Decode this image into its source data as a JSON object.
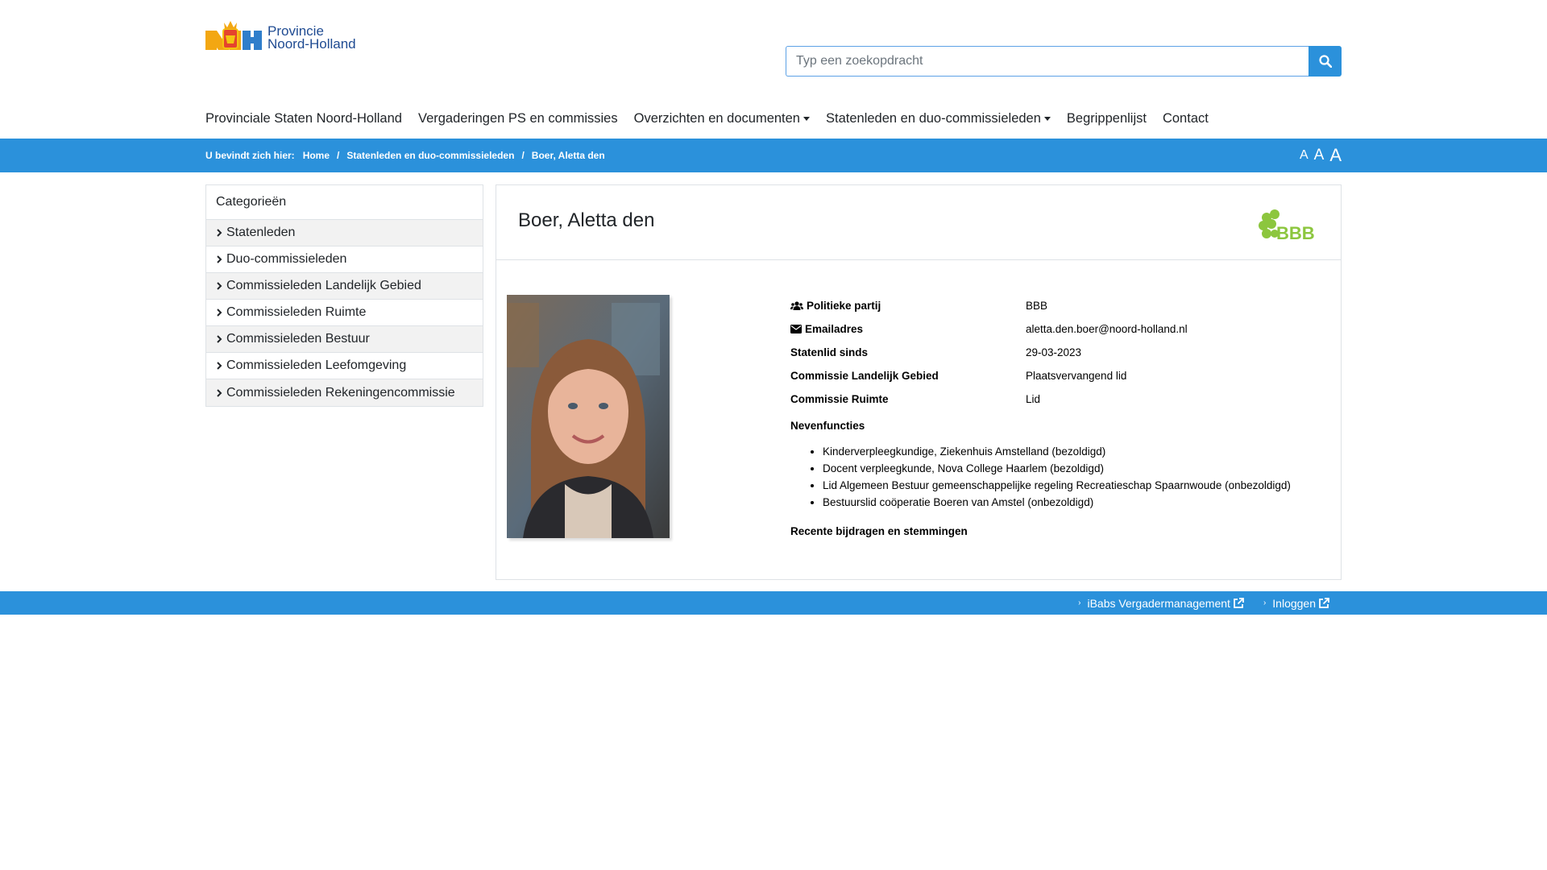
{
  "header": {
    "logo_line1": "Provincie",
    "logo_line2": "Noord-Holland",
    "search_placeholder": "Typ een zoekopdracht"
  },
  "nav": {
    "items": [
      {
        "label": "Provinciale Staten Noord-Holland",
        "dropdown": false
      },
      {
        "label": "Vergaderingen PS en commissies",
        "dropdown": false
      },
      {
        "label": "Overzichten en documenten",
        "dropdown": true
      },
      {
        "label": "Statenleden en duo-commissieleden",
        "dropdown": true
      },
      {
        "label": "Begrippenlijst",
        "dropdown": false
      },
      {
        "label": "Contact",
        "dropdown": false
      }
    ]
  },
  "breadcrumb": {
    "label": "U bevindt zich hier:",
    "items": [
      "Home",
      "Statenleden en duo-commissieleden",
      "Boer, Aletta den"
    ],
    "font_sizes": [
      "A",
      "A",
      "A"
    ]
  },
  "sidebar": {
    "title": "Categorieën",
    "items": [
      "Statenleden",
      "Duo-commissieleden",
      "Commissieleden Landelijk Gebied",
      "Commissieleden Ruimte",
      "Commissieleden Bestuur",
      "Commissieleden Leefomgeving",
      "Commissieleden Rekeningencommissie"
    ]
  },
  "profile": {
    "name": "Boer, Aletta den",
    "party_logo_text": "BBB",
    "fields": [
      {
        "key": "Politieke partij",
        "value": "BBB",
        "icon": "users-icon"
      },
      {
        "key": "Emailadres",
        "value": "aletta.den.boer@noord-holland.nl",
        "icon": "envelope-icon"
      },
      {
        "key": "Statenlid sinds",
        "value": "29-03-2023",
        "icon": ""
      },
      {
        "key": "Commissie Landelijk Gebied",
        "value": "Plaatsvervangend lid",
        "icon": ""
      },
      {
        "key": "Commissie Ruimte",
        "value": "Lid",
        "icon": ""
      }
    ],
    "nevenfuncties_title": "Nevenfuncties",
    "nevenfuncties": [
      "Kinderverpleegkundige, Ziekenhuis Amstelland (bezoldigd)",
      "Docent verpleegkunde, Nova College Haarlem (bezoldigd)",
      "Lid Algemeen Bestuur gemeenschappelijke regeling Recreatieschap Spaarnwoude (onbezoldigd)",
      "Bestuurslid coöperatie Boeren van Amstel (onbezoldigd)"
    ],
    "recent_title": "Recente bijdragen en stemmingen"
  },
  "footer": {
    "links": [
      "iBabs Vergadermanagement",
      "Inloggen"
    ]
  },
  "colors": {
    "brand_blue": "#2b91db",
    "logo_navy": "#1f4b92",
    "bbb_green": "#8cc63e"
  }
}
